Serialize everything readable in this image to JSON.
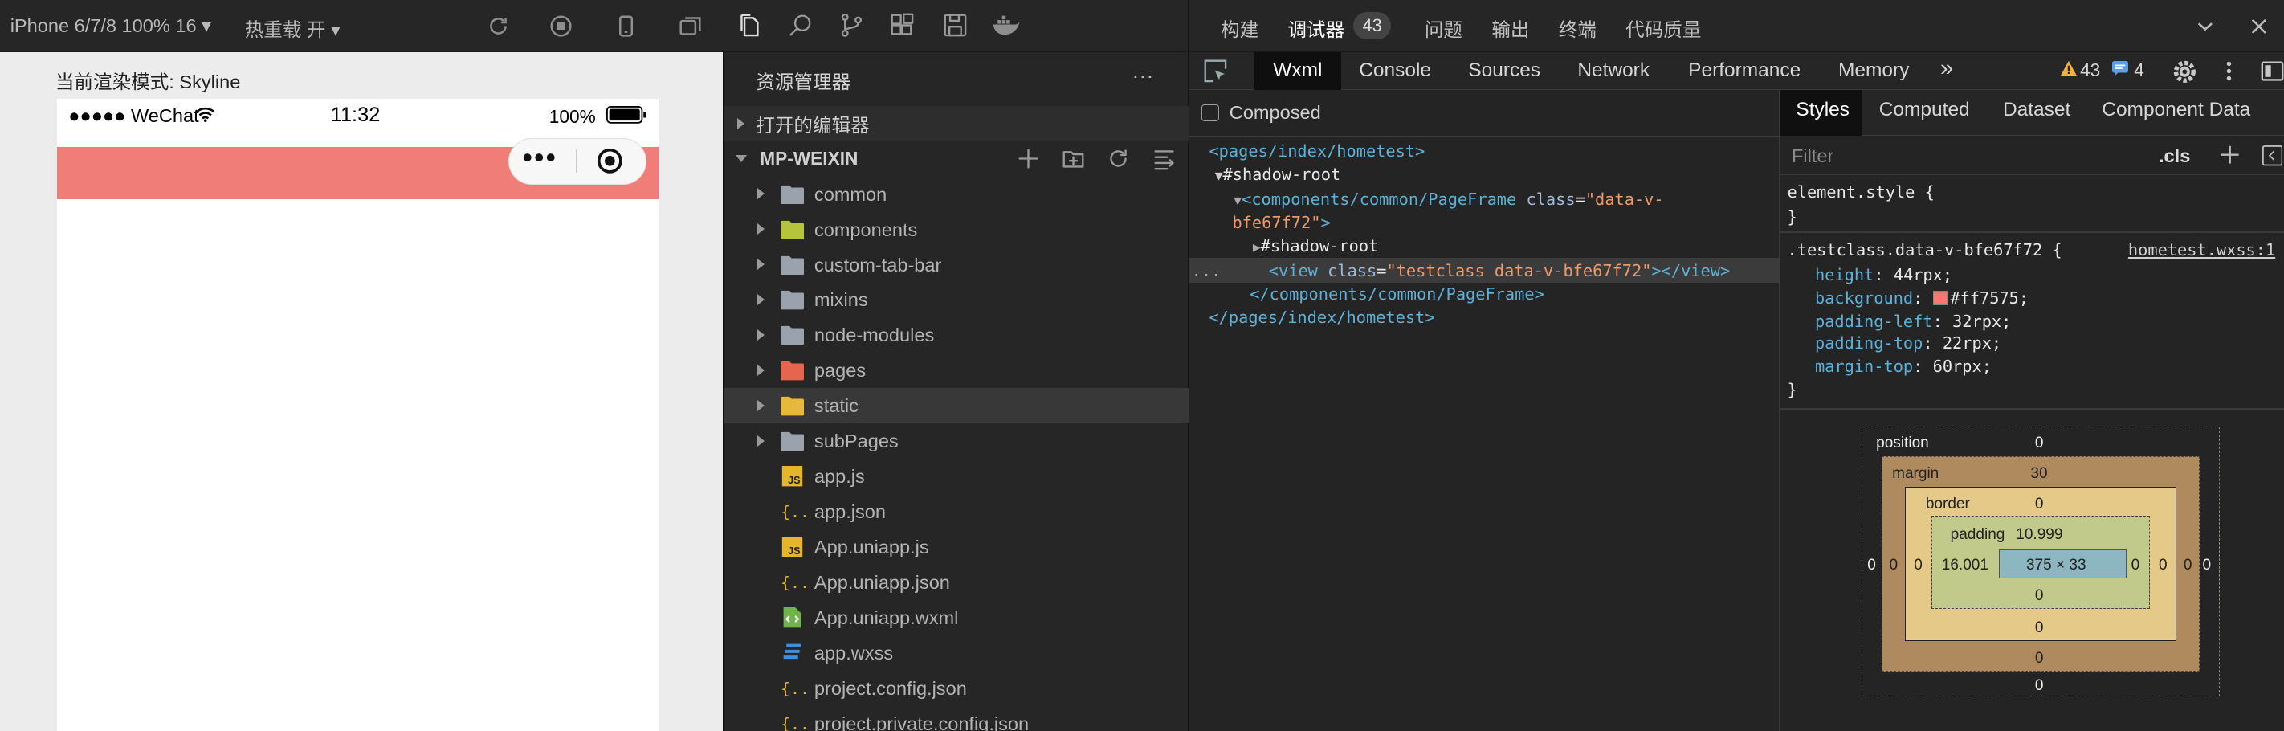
{
  "simulator": {
    "device": "iPhone 6/7/8 100% 16 ▾",
    "hotreload": "热重载 开 ▾",
    "render_mode": "当前渲染模式: Skyline",
    "status": {
      "signal": "●●●●● WeChat",
      "time": "11:32",
      "battery": "100%"
    },
    "capsule_dots": "•••",
    "page_bg": "#ff7575"
  },
  "explorer": {
    "title": "资源管理器",
    "more": "···",
    "open_editors": "打开的编辑器",
    "project": "MP-WEIXIN",
    "items": [
      {
        "name": "common",
        "kind": "folder",
        "expandable": true
      },
      {
        "name": "components",
        "kind": "folder-components",
        "expandable": true
      },
      {
        "name": "custom-tab-bar",
        "kind": "folder",
        "expandable": true
      },
      {
        "name": "mixins",
        "kind": "folder",
        "expandable": true
      },
      {
        "name": "node-modules",
        "kind": "folder",
        "expandable": true
      },
      {
        "name": "pages",
        "kind": "folder-pages",
        "expandable": true
      },
      {
        "name": "static",
        "kind": "folder-static",
        "expandable": true,
        "selected": true
      },
      {
        "name": "subPages",
        "kind": "folder",
        "expandable": true
      },
      {
        "name": "app.js",
        "kind": "js",
        "icon_text": "JS"
      },
      {
        "name": "app.json",
        "kind": "json",
        "icon_text": "{..}"
      },
      {
        "name": "App.uniapp.js",
        "kind": "js",
        "icon_text": "JS"
      },
      {
        "name": "App.uniapp.json",
        "kind": "json",
        "icon_text": "{..}"
      },
      {
        "name": "App.uniapp.wxml",
        "kind": "wxml",
        "icon_text": "<>"
      },
      {
        "name": "app.wxss",
        "kind": "wxss",
        "icon_text": "≡"
      },
      {
        "name": "project.config.json",
        "kind": "json",
        "icon_text": "{..}"
      },
      {
        "name": "project.private.config.json",
        "kind": "json",
        "icon_text": "{..}"
      }
    ]
  },
  "devtools": {
    "top_tabs": [
      "构建",
      "调试器",
      "问题",
      "输出",
      "终端",
      "代码质量"
    ],
    "debugger_badge": "43",
    "panel_tabs": [
      "Wxml",
      "Console",
      "Sources",
      "Network",
      "Performance",
      "Memory"
    ],
    "more_tabs": "»",
    "warnings": "43",
    "messages": "4",
    "composed_label": "Composed",
    "dom": {
      "l1_open": "<pages/index/hometest>",
      "shadow_root": "#shadow-root",
      "l3_tag": "<components/common/PageFrame",
      "l3_attr": "class",
      "l3_val_a": "\"data-v-",
      "l3_val_b": "bfe67f72\"",
      "l3_close": ">",
      "inner_shadow": "#shadow-root",
      "view_tag_open": "<view",
      "view_attr": "class",
      "view_val": "\"testclass data-v-bfe67f72\"",
      "view_tag_close": "></view>",
      "l6": "</components/common/PageFrame>",
      "l7": "</pages/index/hometest>",
      "ellipsis": "..."
    },
    "styles_tabs": [
      "Styles",
      "Computed",
      "Dataset",
      "Component Data"
    ],
    "filter_placeholder": "Filter",
    "cls": ".cls",
    "element_style": "element.style {",
    "close_brace": "}",
    "rule_selector": ".testclass.data-v-bfe67f72 {",
    "rule_source": "hometest.wxss:1",
    "rules": [
      {
        "prop": "height",
        "value": "44rpx;"
      },
      {
        "prop": "background",
        "value": "#ff7575;",
        "swatch": "#ff7575"
      },
      {
        "prop": "padding-left",
        "value": "32rpx;"
      },
      {
        "prop": "padding-top",
        "value": "22rpx;"
      },
      {
        "prop": "margin-top",
        "value": "60rpx;"
      }
    ],
    "box_model": {
      "position_label": "position",
      "position": "0",
      "margin_label": "margin",
      "margin_top": "30",
      "margin_right": "0",
      "margin_bottom": "0",
      "margin_left": "0",
      "border_label": "border",
      "border_top": "0",
      "border_right": "0",
      "border_bottom": "0",
      "border_left": "0",
      "padding_label": "padding",
      "padding_top": "10.999",
      "padding_right": "0",
      "padding_bottom": "0",
      "padding_left": "16.001",
      "content": "375 × 33",
      "pos_right": "0",
      "pos_bottom": "0",
      "pos_left": "0"
    }
  }
}
